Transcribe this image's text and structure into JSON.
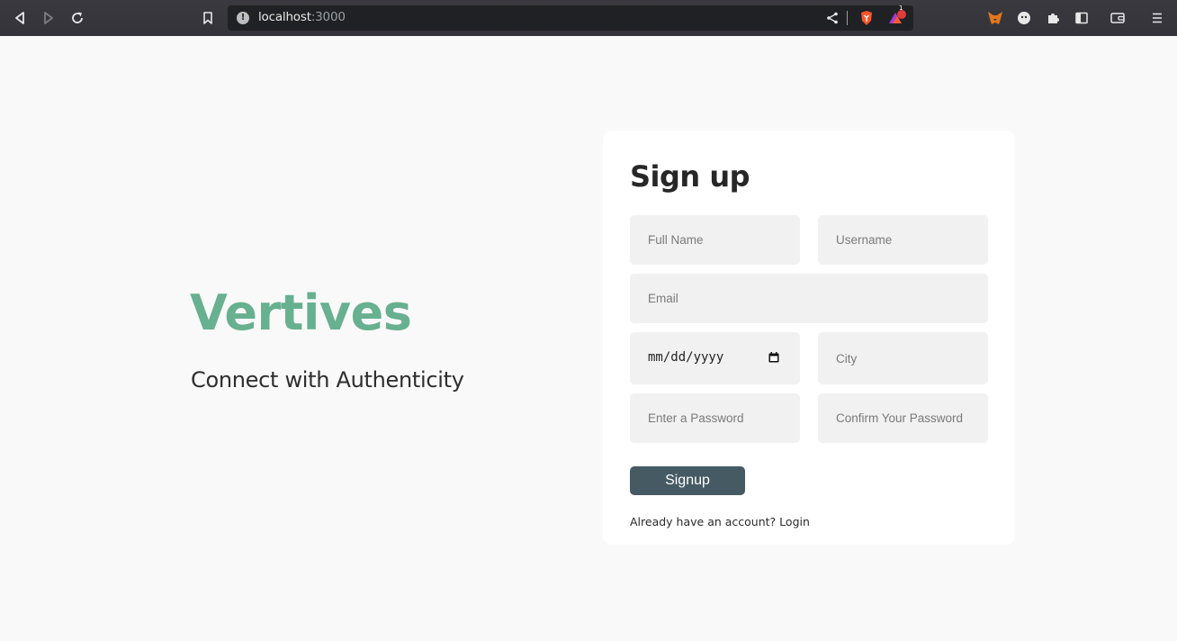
{
  "browser": {
    "url_host": "localhost",
    "url_port": ":3000",
    "notification_count": "1"
  },
  "hero": {
    "brand": "Vertives",
    "tagline": "Connect with Authenticity"
  },
  "form": {
    "title": "Sign up",
    "full_name_placeholder": "Full Name",
    "username_placeholder": "Username",
    "email_placeholder": "Email",
    "date_placeholder": "mm/dd/yyyy",
    "city_placeholder": "City",
    "password_placeholder": "Enter a Password",
    "confirm_password_placeholder": "Confirm Your Password",
    "submit_label": "Signup",
    "login_prompt": "Already have an account?",
    "login_link": "Login"
  },
  "colors": {
    "brand": "#67b090",
    "button": "#465a64",
    "field_bg": "#f0f1f0"
  }
}
